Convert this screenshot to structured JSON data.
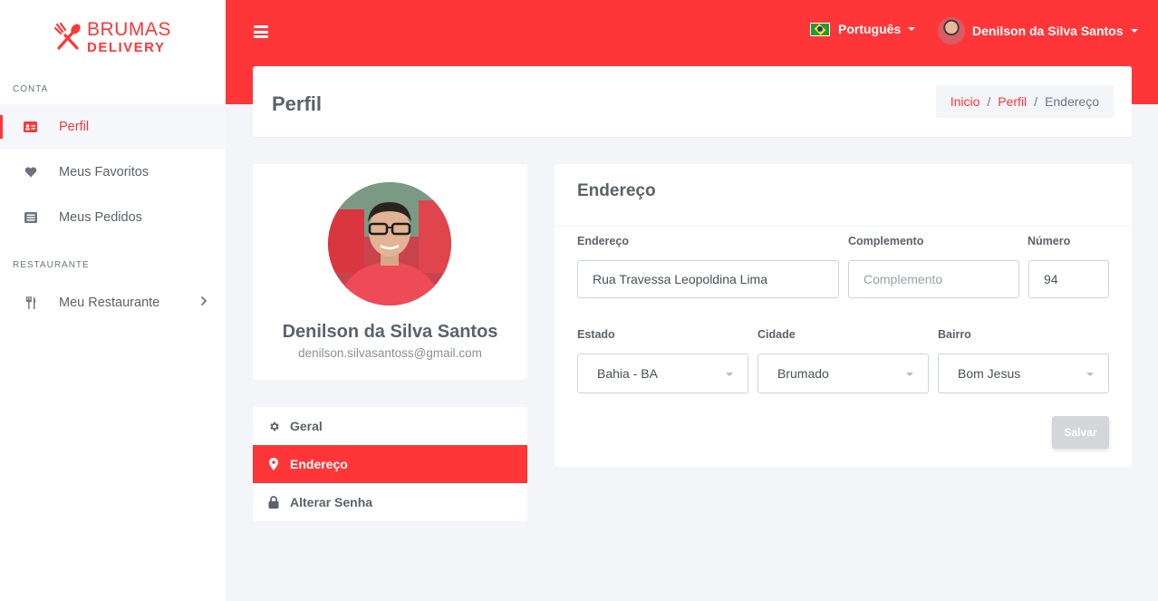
{
  "brand": {
    "line1": "BRUMAS",
    "line2": "DELIVERY",
    "accent": "#ff3638"
  },
  "sidebar": {
    "sections": [
      {
        "title": "CONTA"
      },
      {
        "title": "RESTAURANTE"
      }
    ],
    "items": [
      {
        "label": "Perfil",
        "icon": "id-card-icon",
        "active": true
      },
      {
        "label": "Meus Favoritos",
        "icon": "heart-icon"
      },
      {
        "label": "Meus Pedidos",
        "icon": "list-icon"
      },
      {
        "label": "Meu Restaurante",
        "icon": "utensils-icon"
      }
    ]
  },
  "header": {
    "language": "Português",
    "user_name": "Denilson da Silva Santos"
  },
  "page": {
    "title": "Perfil",
    "breadcrumb": [
      {
        "label": "Inicio"
      },
      {
        "label": "Perfil"
      },
      {
        "label": "Endereço"
      }
    ]
  },
  "profile": {
    "name": "Denilson da Silva Santos",
    "email": "denilson.silvasantoss@gmail.com"
  },
  "profile_menu": [
    {
      "label": "Geral",
      "icon": "gear-icon"
    },
    {
      "label": "Endereço",
      "icon": "map-pin-icon",
      "active": true
    },
    {
      "label": "Alterar Senha",
      "icon": "lock-icon"
    }
  ],
  "address_form": {
    "title": "Endereço",
    "fields": {
      "endereco": {
        "label": "Endereço",
        "value": "Rua Travessa Leopoldina Lima",
        "placeholder": ""
      },
      "complemento": {
        "label": "Complemento",
        "value": "",
        "placeholder": "Complemento"
      },
      "numero": {
        "label": "Número",
        "value": "94",
        "placeholder": ""
      },
      "estado": {
        "label": "Estado",
        "value": "Bahia - BA"
      },
      "cidade": {
        "label": "Cidade",
        "value": "Brumado"
      },
      "bairro": {
        "label": "Bairro",
        "value": "Bom Jesus"
      }
    },
    "save_label": "Salvar"
  }
}
